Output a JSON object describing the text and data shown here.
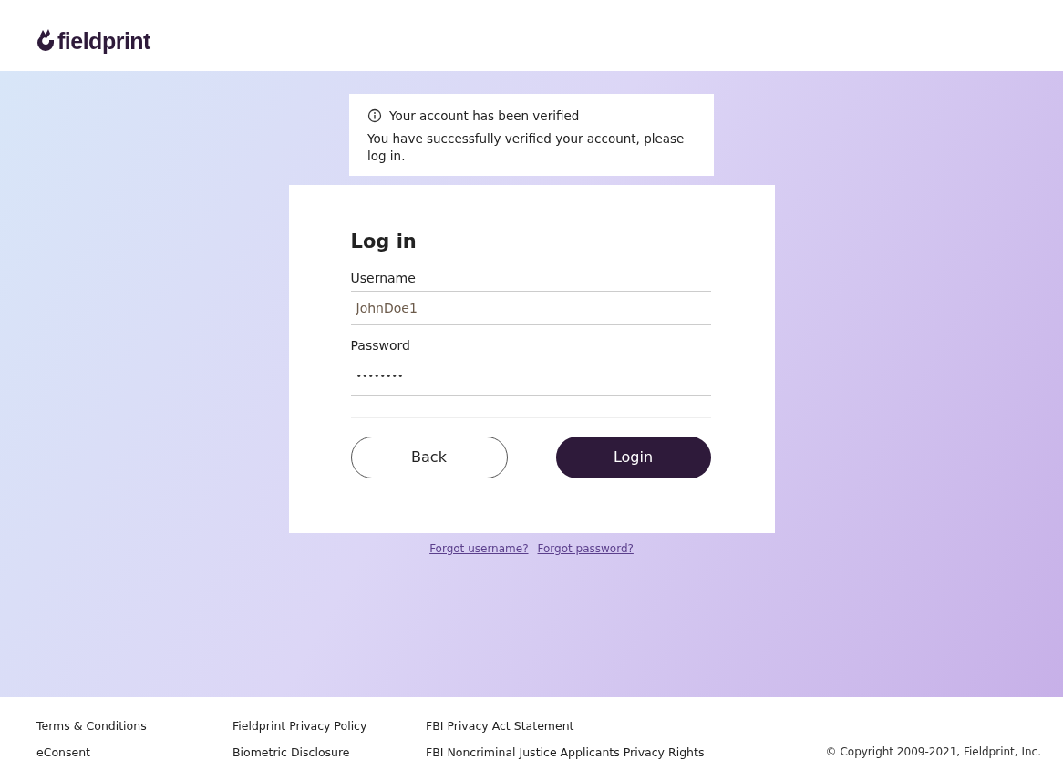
{
  "header": {
    "logo": "fieldprint"
  },
  "notice": {
    "title": "Your account has been verified",
    "message": "You have successfully verified your account, please log in."
  },
  "login": {
    "title": "Log in",
    "username": {
      "label": "Username",
      "value": "JohnDoe1"
    },
    "password": {
      "label": "Password",
      "value": "••••••••"
    },
    "buttons": [
      {
        "label": "Back",
        "kind": "secondary"
      },
      {
        "label": "Login",
        "kind": "primary"
      }
    ]
  },
  "links": [
    "Forgot username?",
    "Forgot password?"
  ],
  "footer": {
    "columns": [
      [
        "Terms & Conditions",
        "eConsent"
      ],
      [
        "Fieldprint Privacy Policy",
        "Biometric Disclosure"
      ],
      [
        "FBI Privacy Act Statement",
        "FBI Noncriminal Justice Applicants Privacy Rights"
      ]
    ],
    "copyright": "© Copyright 2009-2021, Fieldprint, Inc."
  }
}
